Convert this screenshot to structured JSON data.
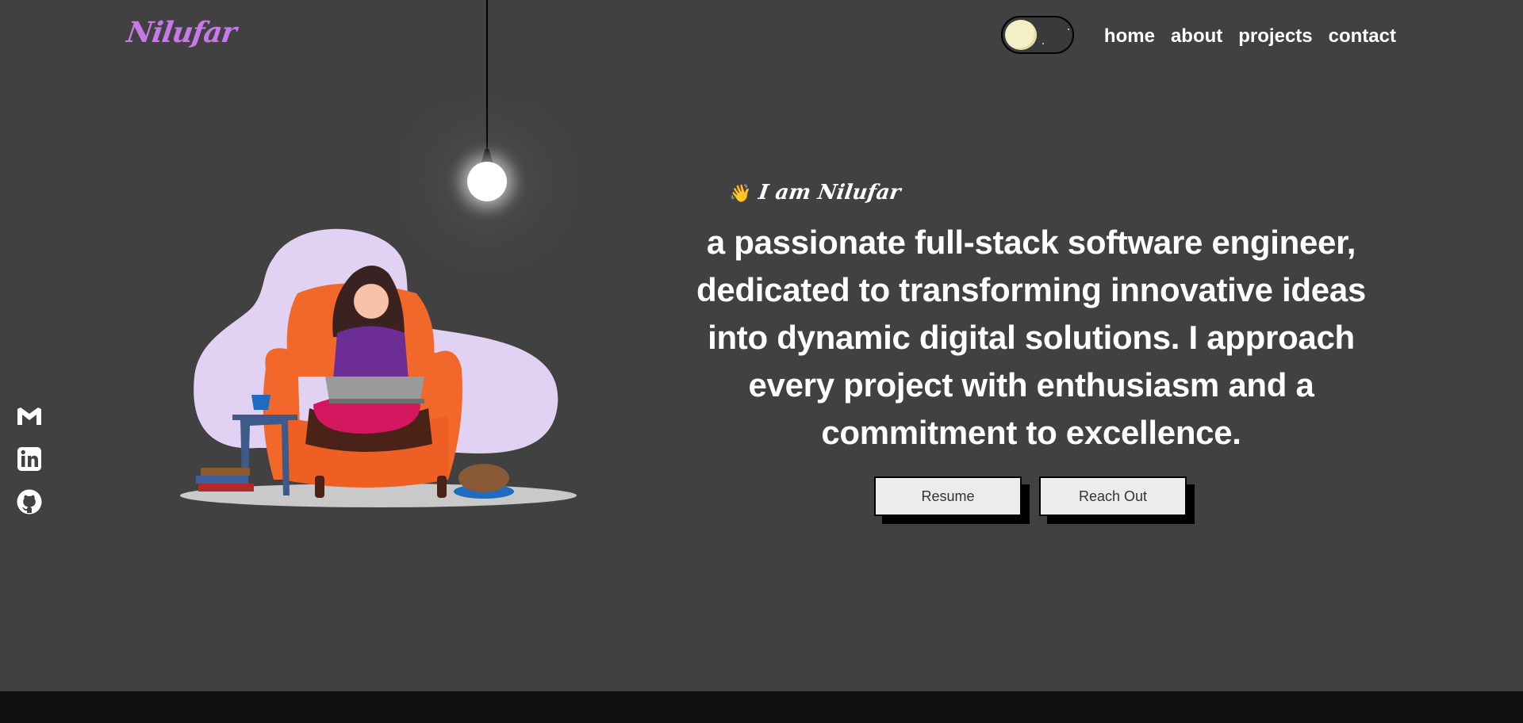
{
  "header": {
    "logo": "Nilufar",
    "theme_toggle_icon": "moon-icon",
    "nav": [
      "home",
      "about",
      "projects",
      "contact"
    ]
  },
  "hero": {
    "wave_emoji": "👋",
    "greeting": "I am Nilufar",
    "tagline_lines": [
      "a passionate full-stack software engineer,",
      "dedicated to transforming innovative ideas",
      "into dynamic digital solutions. I approach",
      "every project with enthusiasm and a",
      "commitment to excellence."
    ],
    "buttons": {
      "resume": "Resume",
      "reach_out": "Reach Out"
    }
  },
  "social": [
    {
      "icon": "gmail-icon"
    },
    {
      "icon": "linkedin-icon"
    },
    {
      "icon": "github-icon"
    }
  ],
  "colors": {
    "background": "#414141",
    "logo": "#c779e8",
    "text": "#ffffff",
    "button_bg": "#ececec",
    "footer": "#111111"
  }
}
